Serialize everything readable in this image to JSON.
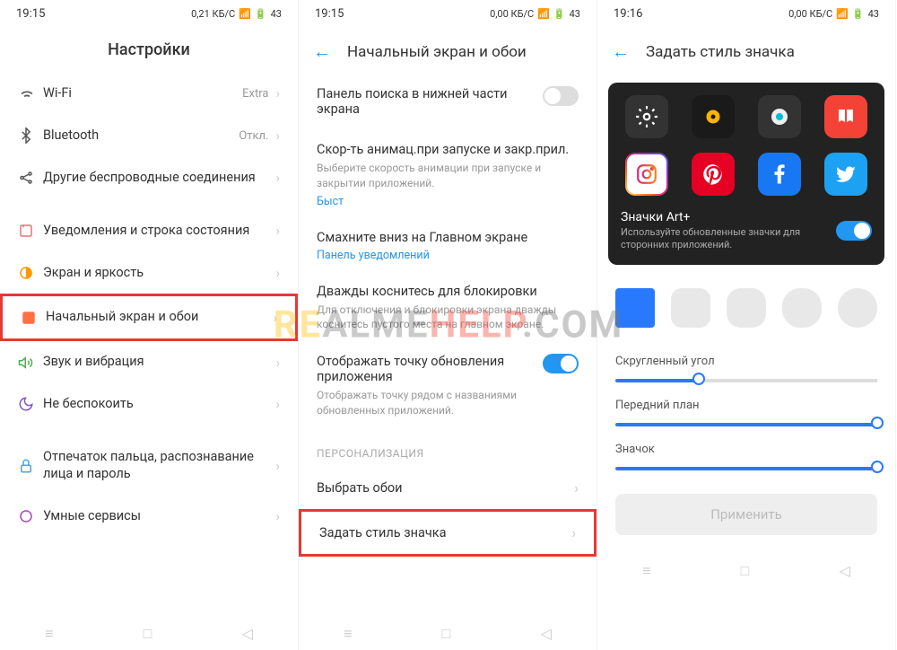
{
  "screen1": {
    "time": "19:15",
    "net": "0,21 КБ/С",
    "battery": "43",
    "title": "Настройки",
    "items": [
      {
        "icon": "wifi",
        "label": "Wi-Fi",
        "value": "Extra"
      },
      {
        "icon": "bluetooth",
        "label": "Bluetooth",
        "value": "Откл."
      },
      {
        "icon": "share",
        "label": "Другие беспроводные соединения",
        "value": ""
      },
      {
        "icon": "bell",
        "label": "Уведомления и строка состояния",
        "value": ""
      },
      {
        "icon": "brightness",
        "label": "Экран и яркость",
        "value": ""
      },
      {
        "icon": "home",
        "label": "Начальный экран и обои",
        "value": "",
        "highlight": true
      },
      {
        "icon": "sound",
        "label": "Звук и вибрация",
        "value": ""
      },
      {
        "icon": "moon",
        "label": "Не беспокоить",
        "value": ""
      },
      {
        "icon": "lock",
        "label": "Отпечаток пальца, распознавание лица и пароль",
        "value": ""
      },
      {
        "icon": "smart",
        "label": "Умные сервисы",
        "value": ""
      }
    ]
  },
  "screen2": {
    "time": "19:15",
    "net": "0,00 КБ/С",
    "battery": "43",
    "title": "Начальный экран и обои",
    "items": [
      {
        "title": "Панель поиска в нижней части экрана",
        "toggle": false
      },
      {
        "title": "Скор-ть анимац.при запуске и закр.прил.",
        "desc": "Выберите скорость анимации при запуске и закрытии приложений.",
        "link": "Быст"
      },
      {
        "title": "Смахните вниз на Главном экране",
        "link": "Панель уведомлений"
      },
      {
        "title": "Дважды коснитесь для блокировки",
        "desc": "Для отключения и блокировки экрана дважды коснитесь пустого места на главном экране."
      },
      {
        "title": "Отображать точку обновления приложения",
        "desc": "Отображать точку рядом с названиями обновленных приложений.",
        "toggle": true
      }
    ],
    "section": "ПЕРСОНАЛИЗАЦИЯ",
    "sub": [
      {
        "label": "Выбрать обои"
      },
      {
        "label": "Задать стиль значка",
        "highlight": true
      }
    ]
  },
  "screen3": {
    "time": "19:16",
    "net": "0,00 КБ/С",
    "battery": "43",
    "title": "Задать стиль значка",
    "art_title": "Значки Art+",
    "art_desc": "Используйте обновленные значки для сторонних приложений.",
    "sliders": [
      {
        "label": "Скругленный угол",
        "pos": 32
      },
      {
        "label": "Передний план",
        "pos": 100
      },
      {
        "label": "Значок",
        "pos": 100
      }
    ],
    "apply": "Применить"
  },
  "watermark": {
    "a": "RE",
    "b": "HELP",
    "c": ".COM"
  }
}
